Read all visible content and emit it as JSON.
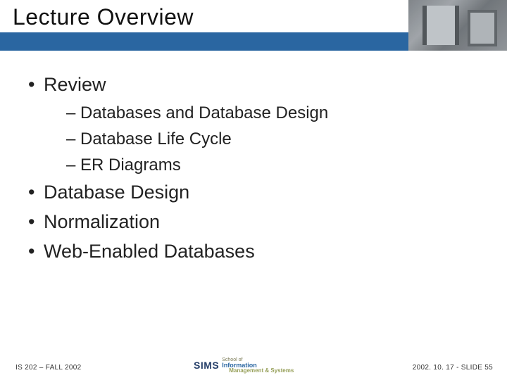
{
  "title": "Lecture Overview",
  "bullets": {
    "b1": "Review",
    "b1_subs": {
      "s1": "Databases and Database Design",
      "s2": "Database Life Cycle",
      "s3": "ER Diagrams"
    },
    "b2": "Database Design",
    "b3": "Normalization",
    "b4": "Web-Enabled Databases"
  },
  "footer": {
    "left": "IS 202 – FALL 2002",
    "right": "2002. 10. 17 -  SLIDE 55",
    "logo_mark": "SIMS",
    "logo_line1": "School of",
    "logo_line2": "Information",
    "logo_line3": "Management & Systems"
  }
}
